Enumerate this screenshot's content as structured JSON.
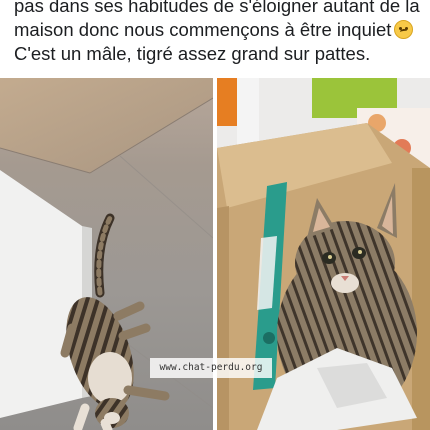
{
  "post": {
    "lines": [
      "pas dans ses habitudes de s'éloigner autant de la",
      "maison donc nous commençons à être inquiet",
      "C'est un mâle,  tigré assez grand sur pattes."
    ],
    "emoji_icon": "worried-face"
  },
  "photos": {
    "left_alt": "chat tigré allongé sur le carrelage",
    "right_alt": "chat tigré dans un carton",
    "watermark": "www.chat-perdu.org"
  },
  "colors": {
    "text": "#1c1e21",
    "floor": "#9c9894",
    "cardboard": "#c9a777",
    "teal_pack": "#2a9c8c",
    "tabby": "#7a6a55"
  }
}
